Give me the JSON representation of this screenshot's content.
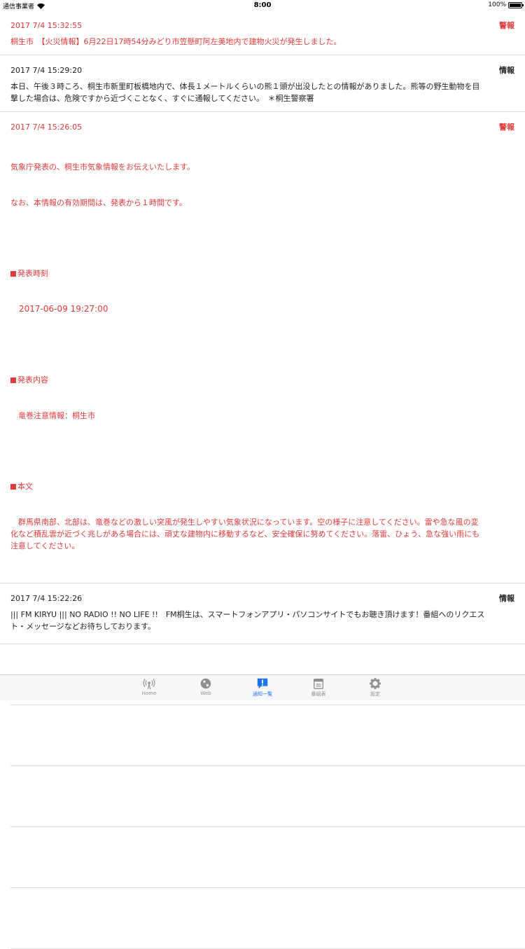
{
  "status_bar": {
    "carrier": "通信事業者",
    "time": "8:00",
    "battery": "100%"
  },
  "notifications": [
    {
      "date": "2017 7/4 15:32:55",
      "tag": "警報",
      "severity": "red",
      "lines": [
        "桐生市　【火災情報】6月22日17時54分みどり市笠懸町阿左美地内で建物火災が発生しました。"
      ]
    },
    {
      "date": "2017 7/4 15:29:20",
      "tag": "情報",
      "severity": "black",
      "lines": [
        "本日、午後３時ころ、桐生市新里町板橋地内で、体長１メートルくらいの熊１頭が出没したとの情報がありました。熊等の野生動物を目",
        "撃した場合は、危険ですから近づくことなく、すぐに通報してください。　＊桐生警察署"
      ]
    },
    {
      "date": "2017 7/4 15:26:05",
      "tag": "警報",
      "severity": "red",
      "intro": [
        "気象庁発表の、桐生市気象情報をお伝えいたします。",
        "なお、本情報の有効期間は、発表から１時間です。"
      ],
      "sections": [
        {
          "heading": "発表時刻",
          "value": "　2017-06-09 19:27:00"
        },
        {
          "heading": "発表内容",
          "value": "　竜巻注意情報：桐生市"
        },
        {
          "heading": "本文",
          "value": "　群馬県南部、北部は、竜巻などの激しい突風が発生しやすい気象状況になっています。空の様子に注意してください。雷や急な風の変\n化など積乱雲が近づく兆しがある場合には、頑丈な建物内に移動するなど、安全確保に努めてください。落雷、ひょう、急な強い雨にも\n注意してください。"
        }
      ]
    },
    {
      "date": "2017 7/4 15:22:26",
      "tag": "情報",
      "severity": "black",
      "lines": [
        "||| FM KIRYU ||| NO RADIO !! NO LIFE !!　FM桐生は、スマートフォンアプリ・パソコンサイトでもお聴き頂けます！番組へのリクエス",
        "ト・メッセージなどお待ちしております。"
      ]
    }
  ],
  "tab_bar": {
    "tabs": [
      {
        "label": "Home",
        "icon": "radio-tower-icon"
      },
      {
        "label": "Web",
        "icon": "globe-icon"
      },
      {
        "label": "通知一覧",
        "icon": "notice-icon",
        "active": true
      },
      {
        "label": "番組表",
        "icon": "calendar-icon"
      },
      {
        "label": "設定",
        "icon": "gear-icon"
      }
    ]
  },
  "colors": {
    "alert_red": "#e03a3a",
    "active_blue": "#1a73e8",
    "inactive_gray": "#8e8e93"
  }
}
